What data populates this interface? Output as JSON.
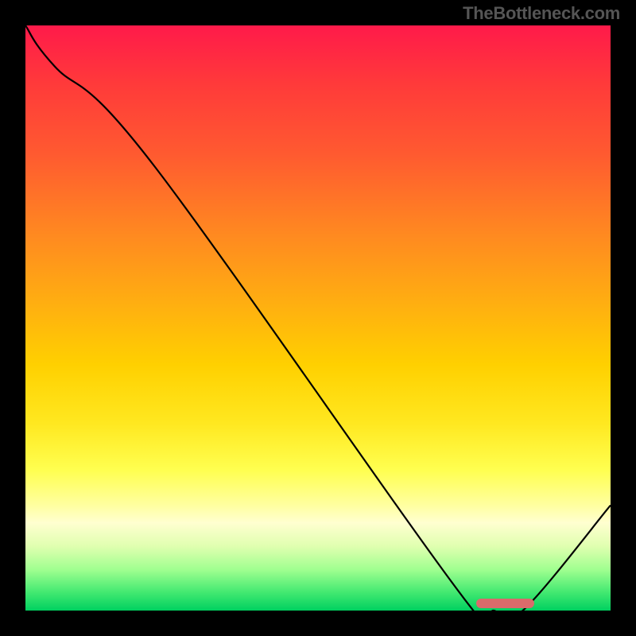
{
  "attribution": "TheBottleneck.com",
  "chart_data": {
    "type": "line",
    "title": "",
    "xlabel": "",
    "ylabel": "",
    "x": [
      0.0,
      0.05,
      0.22,
      0.75,
      0.8,
      0.85,
      1.0
    ],
    "values": [
      1.0,
      0.93,
      0.76,
      0.02,
      0.0,
      0.0,
      0.18
    ],
    "xlim": [
      0,
      1
    ],
    "ylim": [
      0,
      1
    ],
    "marker": {
      "x_start": 0.77,
      "x_end": 0.87,
      "y": 0.01
    },
    "gradient": [
      "#ff1a4a",
      "#ffb010",
      "#ffff50",
      "#00d060"
    ]
  }
}
